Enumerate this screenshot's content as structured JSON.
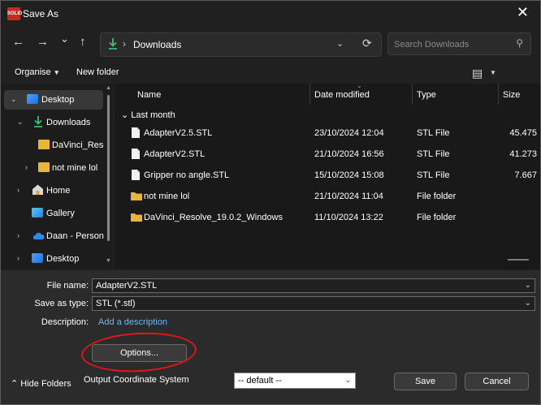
{
  "window": {
    "title": "Save As",
    "app_icon_text": "SOLID"
  },
  "nav": {
    "back_glyph": "←",
    "forward_glyph": "→",
    "recent_glyph": "⌄",
    "up_glyph": "↑",
    "address": "Downloads",
    "address_sep": "›",
    "refresh_glyph": "⟳",
    "search_placeholder": "Search Downloads"
  },
  "toolbar": {
    "organise": "Organise",
    "new_folder": "New folder"
  },
  "sidebar": {
    "items": [
      {
        "label": "Desktop"
      },
      {
        "label": "Downloads"
      },
      {
        "label": "DaVinci_Resc"
      },
      {
        "label": "not mine lol"
      },
      {
        "label": "Home"
      },
      {
        "label": "Gallery"
      },
      {
        "label": "Daan - Persona"
      },
      {
        "label": "Desktop"
      }
    ]
  },
  "files": {
    "columns": {
      "name": "Name",
      "date": "Date modified",
      "type": "Type",
      "size": "Size"
    },
    "group_label": "Last month",
    "rows": [
      {
        "name": "AdapterV2.5.STL",
        "date": "23/10/2024 12:04",
        "type": "STL File",
        "size": "45.475",
        "kind": "file"
      },
      {
        "name": "AdapterV2.STL",
        "date": "21/10/2024 16:56",
        "type": "STL File",
        "size": "41.273",
        "kind": "file"
      },
      {
        "name": "Gripper no angle.STL",
        "date": "15/10/2024 15:08",
        "type": "STL File",
        "size": "7.667",
        "kind": "file"
      },
      {
        "name": "not mine lol",
        "date": "21/10/2024 11:04",
        "type": "File folder",
        "size": "",
        "kind": "folder"
      },
      {
        "name": "DaVinci_Resolve_19.0.2_Windows",
        "date": "11/10/2024 13:22",
        "type": "File folder",
        "size": "",
        "kind": "folder"
      }
    ]
  },
  "form": {
    "file_name_label": "File name:",
    "file_name_value": "AdapterV2.STL",
    "save_type_label": "Save as type:",
    "save_type_value": "STL (*.stl)",
    "description_label": "Description:",
    "description_link": "Add a description",
    "options_button": "Options...",
    "ocs_label": "Output Coordinate System",
    "ocs_value": "-- default --",
    "hide_folders": "Hide Folders",
    "save_button": "Save",
    "cancel_button": "Cancel"
  },
  "colors": {
    "accent_link": "#6cb6ff",
    "folder": "#e8b43a",
    "download_green": "#3fbf6f",
    "annotation": "#e0161c"
  }
}
